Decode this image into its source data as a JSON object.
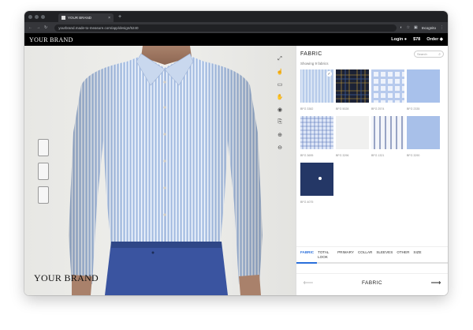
{
  "browser": {
    "tab_title": "YOUR BRAND",
    "url": "yourbrand.made-to-measure.com/app/design/5240",
    "incognito_label": "Incognito"
  },
  "site_header": {
    "brand": "YOUR BRAND",
    "login": "Login",
    "price": "$78",
    "order": "Order"
  },
  "stage": {
    "brand_watermark": "YOUR BRAND",
    "tools": [
      "expand-icon",
      "hand-pointer-icon",
      "save-icon",
      "fit-icon",
      "eye-icon",
      "share-icon",
      "zoom-in-icon",
      "zoom-out-icon"
    ]
  },
  "panel": {
    "title": "FABRIC",
    "search_placeholder": "Search",
    "showing_text": "Showing 9 fabrics",
    "fabrics": [
      {
        "label": "BFG 3382",
        "selected": true
      },
      {
        "label": "BFG 5028",
        "selected": false
      },
      {
        "label": "BFG 2574",
        "selected": false
      },
      {
        "label": "BFG 2335",
        "selected": false
      },
      {
        "label": "BFG 3695",
        "selected": false
      },
      {
        "label": "BFG 3296",
        "selected": false
      },
      {
        "label": "BFG 1321",
        "selected": false
      },
      {
        "label": "BFG 3290",
        "selected": false
      },
      {
        "label": "BFG 4075",
        "selected": false
      }
    ],
    "tabs": [
      "FABRIC",
      "TOTAL LOOK",
      "PRIMARY",
      "COLLAR",
      "SLEEVES",
      "OTHER",
      "SIZE"
    ],
    "active_tab": "FABRIC",
    "nav_label": "FABRIC"
  },
  "colors": {
    "accent": "#2a6fdb",
    "header": "#000000"
  }
}
